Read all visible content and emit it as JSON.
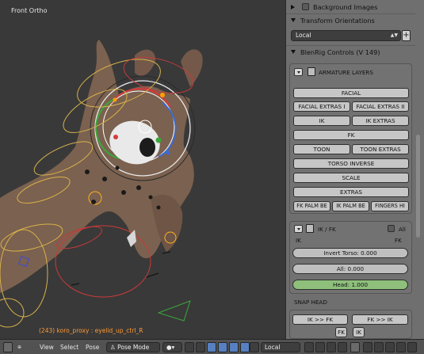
{
  "viewport": {
    "title": "Front Ortho",
    "status_object": "(243) koro_proxy : eyelid_up_ctrl_R"
  },
  "panel": {
    "background_images": "Background Images",
    "transform_orientations": "Transform Orientations",
    "orientation_value": "Local",
    "blenrig_controls": "BlenRig Controls (V 149)",
    "armature_layers": "ARMATURE LAYERS",
    "layer_buttons": {
      "facial": "FACIAL",
      "facial_extras_1": "FACIAL EXTRAS I",
      "facial_extras_2": "FACIAL EXTRAS II",
      "ik": "IK",
      "ik_extras": "IK EXTRAS",
      "fk": "FK",
      "toon": "TOON",
      "toon_extras": "TOON EXTRAS",
      "torso_inverse": "TORSO INVERSE",
      "scale": "SCALE",
      "extras": "EXTRAS",
      "fk_palm": "FK PALM BE",
      "ik_palm": "IK PALM BE",
      "fingers": "FINGERS HI"
    },
    "ikfk": {
      "title": "IK / FK",
      "all_label": "All",
      "ik_label": "IK",
      "fk_label": "FK",
      "invert_torso": "Invert Torso: 0.000",
      "all_slider": "All: 0.000",
      "head_slider": "Head: 1.000",
      "invert_torso_value": 0.0,
      "all_value": 0.0,
      "head_value": 1.0
    },
    "snap_head": "SNAP HEAD",
    "snap": {
      "ik_to_fk": "IK >> FK",
      "fk_to_ik": "FK >> IK",
      "fk_small": "FK",
      "ik_small": "IK"
    }
  },
  "bottombar": {
    "menu_view": "View",
    "menu_select": "Select",
    "menu_pose": "Pose",
    "mode": "Pose Mode",
    "orientation": "Local"
  },
  "colors": {
    "viewport_bg": "#393939",
    "panel_bg": "#6f6f6f",
    "button_bg": "#c6c6c6",
    "slider_green": "#8ec07c",
    "status_text": "#ff9933",
    "character": "#7e6350"
  }
}
